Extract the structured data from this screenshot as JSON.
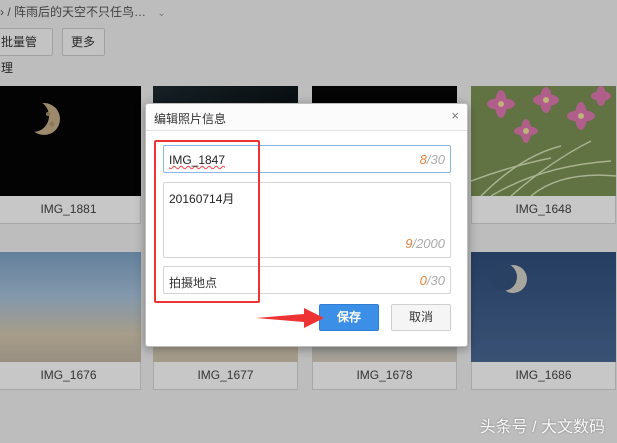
{
  "breadcrumb": {
    "sep": "›",
    "path": "/ 阵雨后的天空不只任鸟…"
  },
  "toolbar": {
    "batch_label": "批量管理",
    "more_label": "更多"
  },
  "photos": [
    {
      "name": "IMG_1881"
    },
    {
      "name": ""
    },
    {
      "name": ""
    },
    {
      "name": "IMG_1648"
    },
    {
      "name": "IMG_1676"
    },
    {
      "name": "IMG_1677"
    },
    {
      "name": "IMG_1678"
    },
    {
      "name": "IMG_1686"
    }
  ],
  "dialog": {
    "title": "编辑照片信息",
    "close_symbol": "×",
    "name_field": {
      "value": "IMG_1847",
      "count": "8",
      "max": "30"
    },
    "desc_field": {
      "value": "20160714月",
      "count": "9",
      "max": "2000"
    },
    "location_field": {
      "placeholder": "拍摄地点",
      "count": "0",
      "max": "30"
    },
    "save_label": "保存",
    "cancel_label": "取消"
  },
  "watermark": "头条号 / 大文数码",
  "colors": {
    "accent": "#3c8fe6",
    "highlight": "#e33333",
    "counter": "#e8833a"
  }
}
